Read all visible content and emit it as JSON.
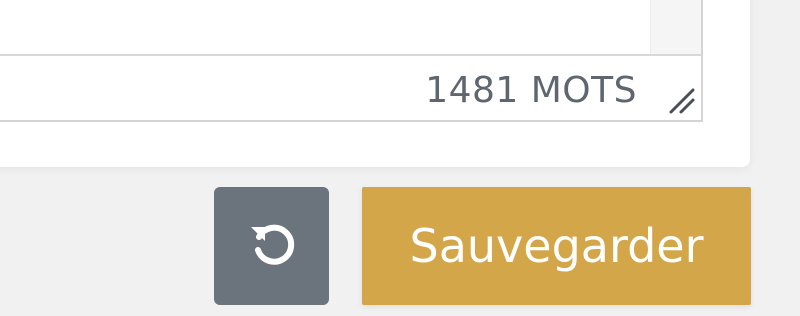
{
  "editor": {
    "word_count": "1481 MOTS"
  },
  "actions": {
    "reset_icon": "undo-icon",
    "save_label": "Sauvegarder"
  },
  "colors": {
    "reset_button_bg": "#6b737d",
    "save_button_bg": "#d4a64a",
    "word_count_text": "#5f6670",
    "page_bg": "#f1f1f2"
  }
}
